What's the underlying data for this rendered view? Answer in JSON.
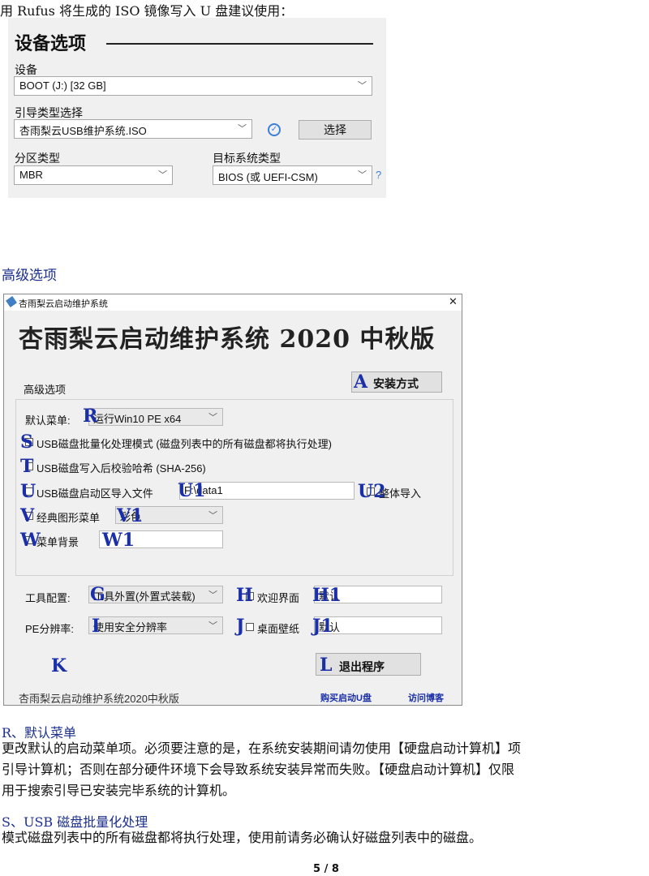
{
  "intro": "用 Rufus 将生成的 ISO 镜像写入 U 盘建议使用：",
  "rufus": {
    "title": "设备选项",
    "device_label": "设备",
    "device_value": "BOOT (J:) [32 GB]",
    "boot_label": "引导类型选择",
    "boot_value": "杏雨梨云USB维护系统.ISO",
    "select_button": "选择",
    "partition_label": "分区类型",
    "partition_value": "MBR",
    "target_label": "目标系统类型",
    "target_value": "BIOS (或 UEFI-CSM)",
    "help": "?"
  },
  "section_heading": "高级选项",
  "window": {
    "title": "杏雨梨云启动维护系统",
    "close": "✕",
    "banner": "杏雨梨云启动维护系统 2020 中秋版",
    "advanced_label": "高级选项",
    "install_button": "安装方式",
    "default_menu_label": "默认菜单:",
    "default_menu_value": "运行Win10 PE x64",
    "usb_batch": "USB磁盘批量化处理模式 (磁盘列表中的所有磁盘都将执行处理)",
    "usb_verify": "USB磁盘写入后校验哈希 (SHA-256)",
    "usb_import": "USB磁盘启动区导入文件",
    "import_path": "F:\\data1",
    "whole_import": "整体导入",
    "classic_menu": "经典图形菜单",
    "classic_value": "彩色",
    "menu_bg": "菜单背景",
    "tool_config_label": "工具配置:",
    "tool_config_value": "工具外置(外置式装载)",
    "welcome_label": "欢迎界面",
    "welcome_value": "默认",
    "pe_res_label": "PE分辨率:",
    "pe_res_value": "使用安全分辨率",
    "wallpaper_label": "桌面壁纸",
    "wallpaper_value": "默认",
    "exit_button": "退出程序",
    "footer_text": "杏雨梨云启动维护系统2020中秋版",
    "buy_link": "购买启动U盘",
    "blog_link": "访问博客"
  },
  "letters": {
    "A": "A",
    "R": "R",
    "S": "S",
    "T": "T",
    "U": "U",
    "U1": "U1",
    "U2": "U2",
    "V": "V",
    "V1": "V1",
    "W": "W",
    "W1": "W1",
    "G": "G",
    "H": "H",
    "H1": "H1",
    "I": "I",
    "J": "J",
    "J1": "J1",
    "K": "K",
    "L": "L"
  },
  "body": {
    "r_heading": "R、默认菜单",
    "r_line1": "更改默认的启动菜单项。必须要注意的是，在系统安装期间请勿使用【硬盘启动计算机】项",
    "r_line2": "引导计算机；否则在部分硬件环境下会导致系统安装异常而失败。【硬盘启动计算机】仅限",
    "r_line3": "用于搜索引导已安装完毕系统的计算机。",
    "s_heading": "S、USB 磁盘批量化处理",
    "s_line1": "模式磁盘列表中的所有磁盘都将执行处理，使用前请务必确认好磁盘列表中的磁盘。"
  },
  "page_number": "5 / 8",
  "colors": {
    "accent_blue": "#1a2fa8",
    "check_blue": "#3b7fd6"
  }
}
